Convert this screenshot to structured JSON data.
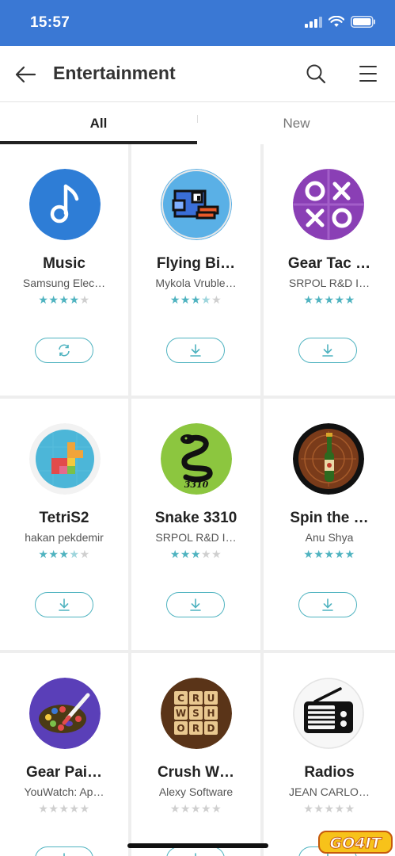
{
  "status_bar": {
    "time": "15:57",
    "background": "#3a78d4"
  },
  "header": {
    "title": "Entertainment",
    "back_icon": "arrow-left-icon",
    "search_icon": "search-icon",
    "menu_icon": "hamburger-icon"
  },
  "tabs": [
    {
      "label": "All",
      "selected": true
    },
    {
      "label": "New",
      "selected": false
    }
  ],
  "accent_color": "#4fb3c0",
  "apps": [
    {
      "name": "Music",
      "developer": "Samsung Elec…",
      "rating": 4,
      "action": "update",
      "icon": "music-note-icon"
    },
    {
      "name": "Flying Bi…",
      "developer": "Mykola Vruble…",
      "rating": 3.5,
      "action": "download",
      "icon": "flappy-bird-icon"
    },
    {
      "name": "Gear Tac …",
      "developer": "SRPOL R&D I…",
      "rating": 5,
      "action": "download",
      "icon": "tic-tac-toe-icon"
    },
    {
      "name": "TetriS2",
      "developer": "hakan pekdemir",
      "rating": 3.5,
      "action": "download",
      "icon": "tetris-blocks-icon"
    },
    {
      "name": "Snake 3310",
      "developer": "SRPOL R&D I…",
      "rating": 3,
      "action": "download",
      "icon": "snake-icon"
    },
    {
      "name": "Spin the …",
      "developer": "Anu Shya",
      "rating": 5,
      "action": "download",
      "icon": "spin-bottle-icon"
    },
    {
      "name": "Gear Pai…",
      "developer": "YouWatch: Ap…",
      "rating": 0,
      "action": "download",
      "icon": "paint-palette-icon"
    },
    {
      "name": "Crush W…",
      "developer": "Alexy Software",
      "rating": 0,
      "action": "download",
      "icon": "word-tiles-icon"
    },
    {
      "name": "Radios",
      "developer": "JEAN CARLO…",
      "rating": 0,
      "action": "download",
      "icon": "radio-icon"
    }
  ],
  "word_tiles": [
    "C",
    "R",
    "U",
    "W",
    "S",
    "H",
    "O",
    "R",
    "D"
  ],
  "snake_label": "3310",
  "watermark": {
    "text": "GO4IT",
    "icon": "go4it-logo"
  }
}
